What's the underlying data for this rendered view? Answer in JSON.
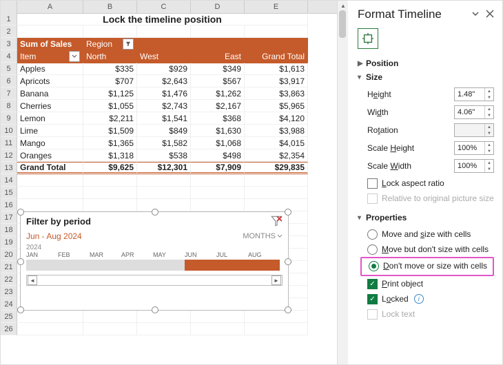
{
  "title": "Lock the timeline position",
  "columns": [
    "A",
    "B",
    "C",
    "D",
    "E"
  ],
  "pivot": {
    "sum_label": "Sum of Sales",
    "region_label": "Region",
    "item_label": "Item",
    "col_headers": [
      "North",
      "West",
      "East",
      "Grand Total"
    ],
    "rows": [
      {
        "item": "Apples",
        "vals": [
          "$335",
          "$929",
          "$349",
          "$1,613"
        ]
      },
      {
        "item": "Apricots",
        "vals": [
          "$707",
          "$2,643",
          "$567",
          "$3,917"
        ]
      },
      {
        "item": "Banana",
        "vals": [
          "$1,125",
          "$1,476",
          "$1,262",
          "$3,863"
        ]
      },
      {
        "item": "Cherries",
        "vals": [
          "$1,055",
          "$2,743",
          "$2,167",
          "$5,965"
        ]
      },
      {
        "item": "Lemon",
        "vals": [
          "$2,211",
          "$1,541",
          "$368",
          "$4,120"
        ]
      },
      {
        "item": "Lime",
        "vals": [
          "$1,509",
          "$849",
          "$1,630",
          "$3,988"
        ]
      },
      {
        "item": "Mango",
        "vals": [
          "$1,365",
          "$1,582",
          "$1,068",
          "$4,015"
        ]
      },
      {
        "item": "Oranges",
        "vals": [
          "$1,318",
          "$538",
          "$498",
          "$2,354"
        ]
      }
    ],
    "grand_label": "Grand Total",
    "grand_vals": [
      "$9,625",
      "$12,301",
      "$7,909",
      "$29,835"
    ]
  },
  "timeline": {
    "title": "Filter by period",
    "period": "Jun - Aug 2024",
    "unit": "MONTHS",
    "year": "2024",
    "months": [
      "JAN",
      "FEB",
      "MAR",
      "APR",
      "MAY",
      "JUN",
      "JUL",
      "AUG"
    ],
    "active_from": 5
  },
  "pane": {
    "title": "Format Timeline",
    "sections": {
      "position": "Position",
      "size": "Size",
      "properties": "Properties"
    },
    "size": {
      "height_label": "Height",
      "height_val": "1.48\"",
      "width_label": "Width",
      "width_val": "4.06\"",
      "rotation_label": "Rotation",
      "rotation_val": "",
      "scaleh_label": "Scale Height",
      "scaleh_val": "100%",
      "scalew_label": "Scale Width",
      "scalew_val": "100%",
      "lock_ar": "Lock aspect ratio",
      "rel_orig": "Relative to original picture size"
    },
    "props": {
      "opt1": "Move and size with cells",
      "opt2": "Move but don't size with cells",
      "opt3": "Don't move or size with cells",
      "print": "Print object",
      "locked": "Locked",
      "locktext": "Lock text"
    }
  }
}
